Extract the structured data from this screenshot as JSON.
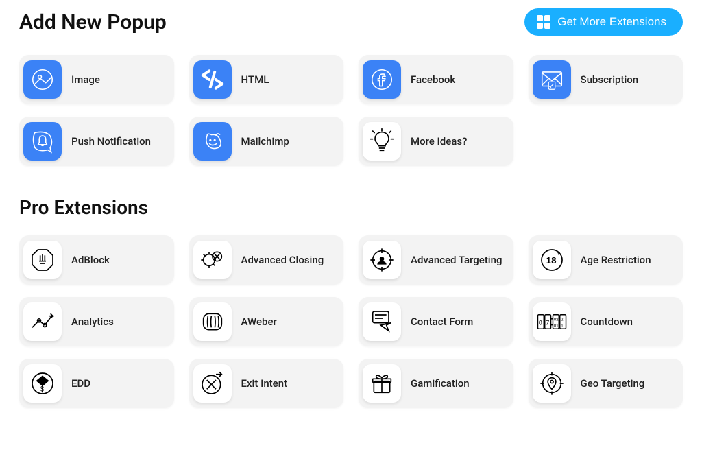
{
  "header": {
    "title": "Add New Popup",
    "get_more_label": "Get More Extensions"
  },
  "popup_types": [
    {
      "id": "image",
      "label": "Image",
      "icon": "image-icon",
      "icon_bg": "blue"
    },
    {
      "id": "html",
      "label": "HTML",
      "icon": "html-icon",
      "icon_bg": "blue"
    },
    {
      "id": "facebook",
      "label": "Facebook",
      "icon": "facebook-icon",
      "icon_bg": "blue"
    },
    {
      "id": "subscription",
      "label": "Subscription",
      "icon": "subscription-icon",
      "icon_bg": "blue"
    },
    {
      "id": "push-notification",
      "label": "Push Notification",
      "icon": "push-notification-icon",
      "icon_bg": "blue"
    },
    {
      "id": "mailchimp",
      "label": "Mailchimp",
      "icon": "mailchimp-icon",
      "icon_bg": "blue"
    },
    {
      "id": "more-ideas",
      "label": "More Ideas?",
      "icon": "lightbulb-icon",
      "icon_bg": "white"
    }
  ],
  "pro_section_title": "Pro Extensions",
  "pro_extensions": [
    {
      "id": "adblock",
      "label": "AdBlock",
      "icon": "adblock-icon"
    },
    {
      "id": "advanced-closing",
      "label": "Advanced Closing",
      "icon": "advanced-closing-icon"
    },
    {
      "id": "advanced-targeting",
      "label": "Advanced Targeting",
      "icon": "advanced-targeting-icon"
    },
    {
      "id": "age-restriction",
      "label": "Age Restriction",
      "icon": "age-restriction-icon"
    },
    {
      "id": "analytics",
      "label": "Analytics",
      "icon": "analytics-icon"
    },
    {
      "id": "aweber",
      "label": "AWeber",
      "icon": "aweber-icon"
    },
    {
      "id": "contact-form",
      "label": "Contact Form",
      "icon": "contact-form-icon"
    },
    {
      "id": "countdown",
      "label": "Countdown",
      "icon": "countdown-icon"
    },
    {
      "id": "edd",
      "label": "EDD",
      "icon": "edd-icon"
    },
    {
      "id": "exit-intent",
      "label": "Exit Intent",
      "icon": "exit-intent-icon"
    },
    {
      "id": "gamification",
      "label": "Gamification",
      "icon": "gamification-icon"
    },
    {
      "id": "geo-targeting",
      "label": "Geo Targeting",
      "icon": "geo-targeting-icon"
    }
  ],
  "colors": {
    "accent": "#3B82F6",
    "button_blue": "#1AAFFF",
    "card_bg": "#f3f3f3"
  }
}
